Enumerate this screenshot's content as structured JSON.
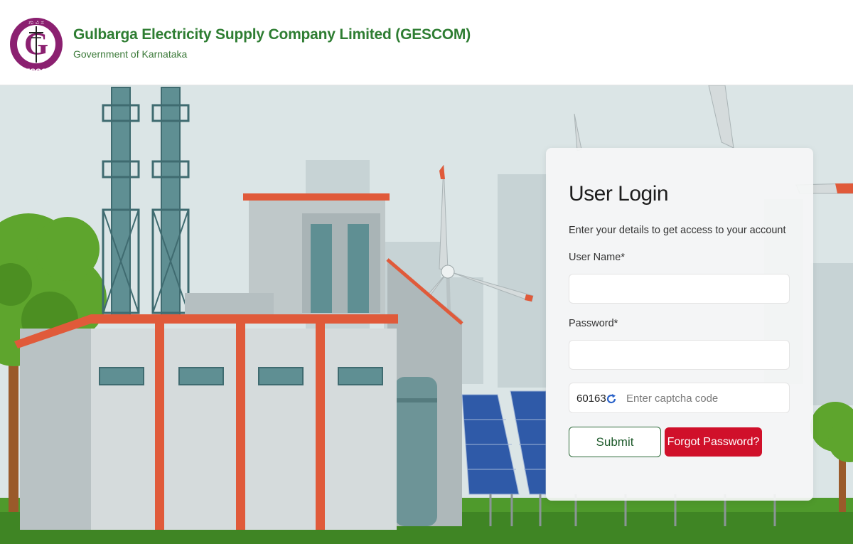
{
  "header": {
    "org_name": "Gulbarga Electricity Supply Company Limited (GESCOM)",
    "subtitle": "Government of Karnataka",
    "logo_text": "GESCOM",
    "logo_letter": "G"
  },
  "login": {
    "title": "User Login",
    "subtitle": "Enter your details to get access to your account",
    "username_label": "User Name*",
    "username_value": "",
    "password_label": "Password*",
    "password_value": "",
    "captcha_code": "60163",
    "captcha_placeholder": "Enter captcha code",
    "submit_label": "Submit",
    "forgot_label": "Forgot Password?"
  },
  "colors": {
    "brand_green": "#2e7d32",
    "logo_purple": "#8b2070",
    "forgot_red": "#d0102a"
  },
  "icons": [
    "gescom-logo-icon",
    "refresh-icon"
  ]
}
